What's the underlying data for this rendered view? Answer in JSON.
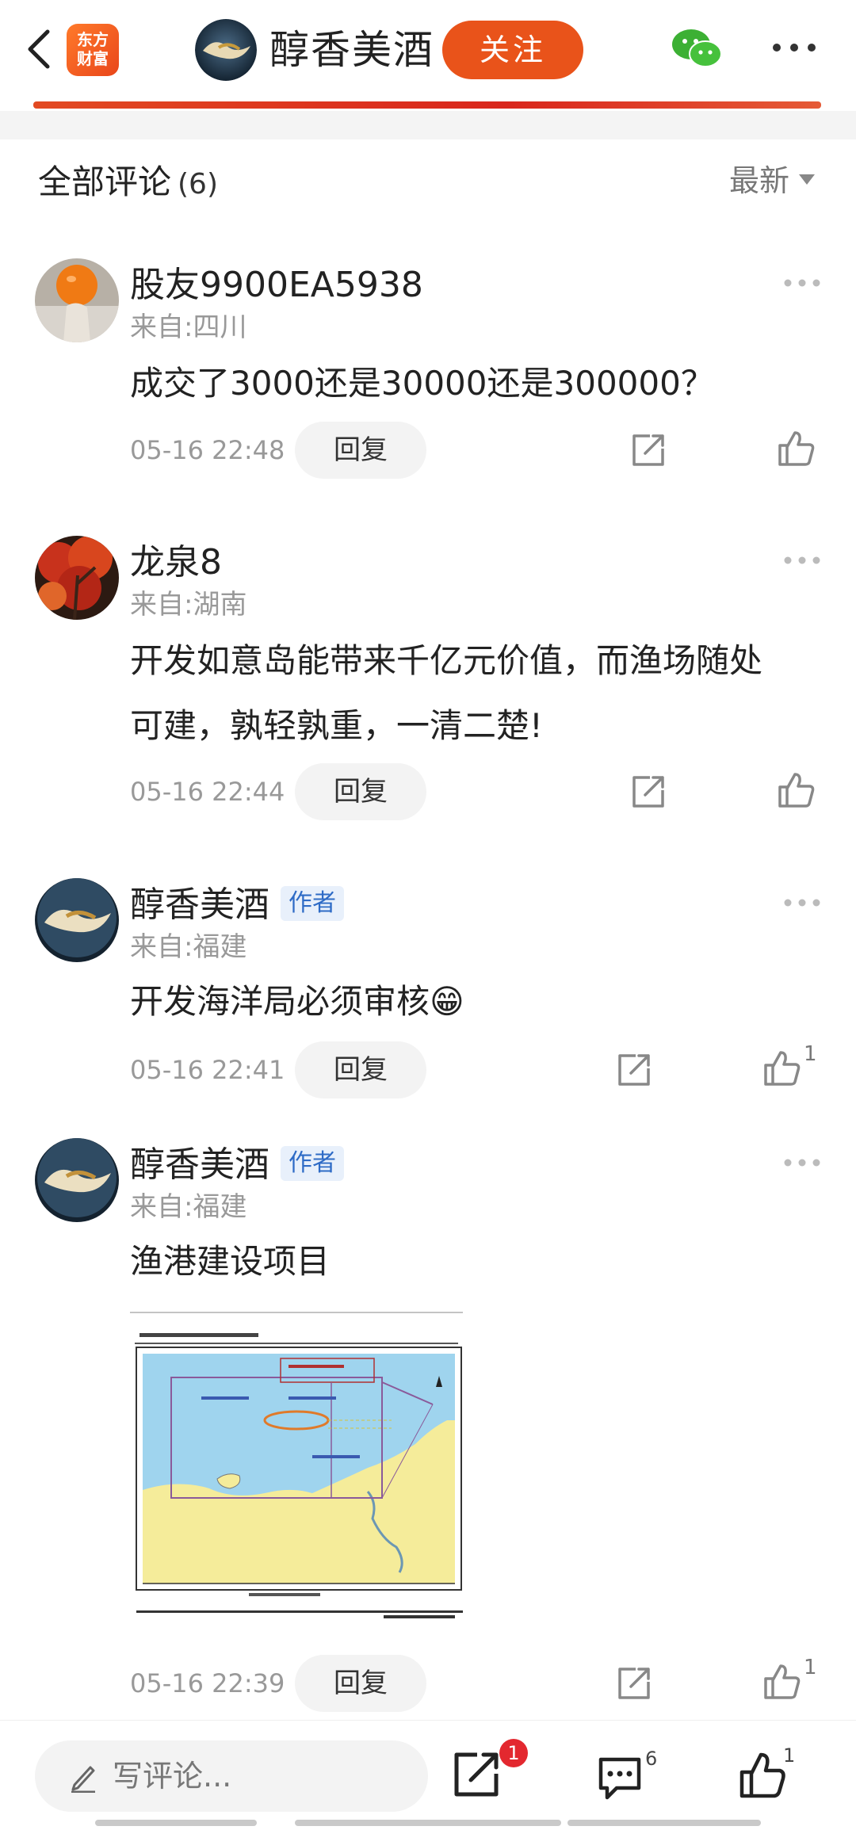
{
  "header": {
    "logo_text_line1": "东方",
    "logo_text_line2": "财富",
    "author_name": "醇香美酒",
    "follow_label": "关注"
  },
  "section": {
    "title": "全部评论",
    "count": "(6)",
    "sort_label": "最新"
  },
  "comments": [
    {
      "user": "股友9900EA5938",
      "from": "来自:四川",
      "text": "成交了3000还是30000还是300000？",
      "time": "05-16 22:48",
      "reply": "回复",
      "likes": ""
    },
    {
      "user": "龙泉8",
      "from": "来自:湖南",
      "text_line1": "开发如意岛能带来千亿元价值，而渔场随处",
      "text_line2": "可建，孰轻孰重，一清二楚!",
      "time": "05-16 22:44",
      "reply": "回复",
      "likes": ""
    },
    {
      "user": "醇香美酒",
      "tag": "作者",
      "from": "来自:福建",
      "text": "开发海洋局必须审核",
      "emoji": "😁",
      "time": "05-16 22:41",
      "reply": "回复",
      "likes": "1"
    },
    {
      "user": "醇香美酒",
      "tag": "作者",
      "from": "来自:福建",
      "text": "渔港建设项目",
      "time": "05-16 22:39",
      "reply": "回复",
      "likes": "1"
    }
  ],
  "bottom": {
    "write_placeholder": "写评论...",
    "share_badge": "1",
    "comment_count": "6",
    "like_count": "1"
  },
  "colors": {
    "accent": "#e9531a",
    "tag_bg": "#e8f0fb",
    "tag_text": "#2e6bc6",
    "badge": "#e3282f"
  }
}
